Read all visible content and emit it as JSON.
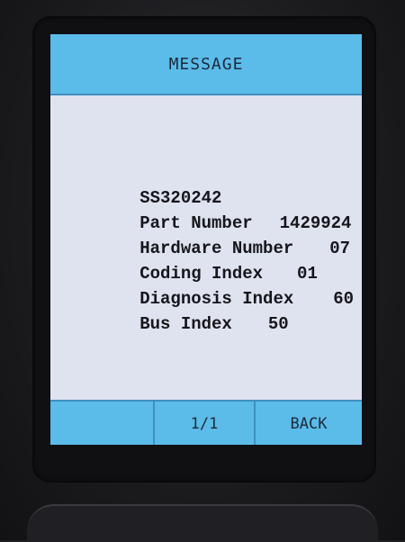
{
  "screen": {
    "title": "MESSAGE",
    "lines": [
      {
        "label": "SS320242",
        "value": ""
      },
      {
        "label": "Part Number",
        "value": "1429924"
      },
      {
        "label": "Hardware Number",
        "value": "07"
      },
      {
        "label": "Coding Index",
        "value": "01"
      },
      {
        "label": "Diagnosis Index",
        "value": "60"
      },
      {
        "label": "Bus Index",
        "value": "50"
      }
    ]
  },
  "footer": {
    "left_label": "",
    "page_indicator": "1/1",
    "back_label": "BACK"
  },
  "colors": {
    "bar": "#5bbbe9",
    "screen_bg": "#dfe3ef",
    "text": "#16161c"
  }
}
